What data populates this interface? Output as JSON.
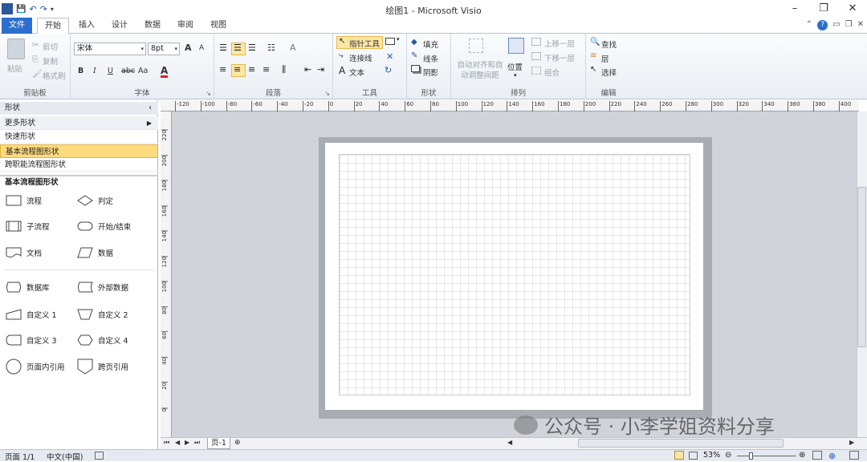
{
  "window": {
    "title": "绘图1  -  Microsoft Visio",
    "min": "–",
    "restore": "❐",
    "close": "✕"
  },
  "qat": {
    "logo": "V",
    "save": "💾",
    "undo": "↶",
    "redo": "↷",
    "more": "▾"
  },
  "tabs": [
    {
      "label": "文件"
    },
    {
      "label": "开始"
    },
    {
      "label": "插入"
    },
    {
      "label": "设计"
    },
    {
      "label": "数据"
    },
    {
      "label": "审阅"
    },
    {
      "label": "视图"
    }
  ],
  "ribbon": {
    "clipboard": {
      "label": "剪贴板",
      "paste": "粘贴",
      "cut": "剪切",
      "copy": "复制",
      "format_painter": "格式刷"
    },
    "font": {
      "label": "字体",
      "family": "宋体",
      "size": "8pt",
      "bold": "B",
      "italic": "I",
      "underline": "U",
      "strike": "abc",
      "case": "Aa",
      "color": "A",
      "grow": "A",
      "shrink": "A"
    },
    "paragraph": {
      "label": "段落"
    },
    "tools": {
      "label": "工具",
      "pointer": "指针工具",
      "connector": "连接线",
      "text": "文本"
    },
    "shape": {
      "label": "形状",
      "fill": "填充",
      "line": "线条",
      "shadow": "阴影"
    },
    "arrange": {
      "label": "排列",
      "auto_align": "自动对齐和自动调整间距",
      "position": "位置",
      "bring_forward": "上移一层",
      "send_backward": "下移一层",
      "group": "组合"
    },
    "editing": {
      "label": "编辑",
      "find": "查找",
      "layers": "层",
      "select": "选择"
    }
  },
  "shapes_panel": {
    "header": "形状",
    "collapse": "‹",
    "more_shapes": "更多形状",
    "stencils": [
      {
        "label": "快速形状"
      },
      {
        "label": "基本流程图形状"
      },
      {
        "label": "跨职能流程图形状"
      }
    ],
    "section_title": "基本流程图形状",
    "items": [
      {
        "label": "流程"
      },
      {
        "label": "判定"
      },
      {
        "label": "子流程"
      },
      {
        "label": "开始/结束"
      },
      {
        "label": "文档"
      },
      {
        "label": "数据"
      },
      {
        "label": "数据库"
      },
      {
        "label": "外部数据"
      },
      {
        "label": "自定义 1"
      },
      {
        "label": "自定义 2"
      },
      {
        "label": "自定义 3"
      },
      {
        "label": "自定义 4"
      },
      {
        "label": "页面内引用"
      },
      {
        "label": "跨页引用"
      }
    ]
  },
  "ruler": {
    "h_ticks": [
      "-120",
      "-100",
      "-80",
      "-60",
      "-40",
      "-20",
      "0",
      "20",
      "40",
      "60",
      "80",
      "100",
      "120",
      "140",
      "160",
      "180",
      "200",
      "220",
      "240",
      "260",
      "280",
      "300",
      "320",
      "340",
      "360",
      "380",
      "400"
    ],
    "v_ticks": [
      "220",
      "200",
      "180",
      "160",
      "140",
      "120",
      "100",
      "80",
      "60",
      "40",
      "20",
      "0"
    ]
  },
  "pagebar": {
    "page_tab": "页-1"
  },
  "status": {
    "page": "页面 1/1",
    "language": "中文(中国)",
    "zoom": "53%"
  },
  "watermark": "公众号 · 小李学姐资料分享"
}
